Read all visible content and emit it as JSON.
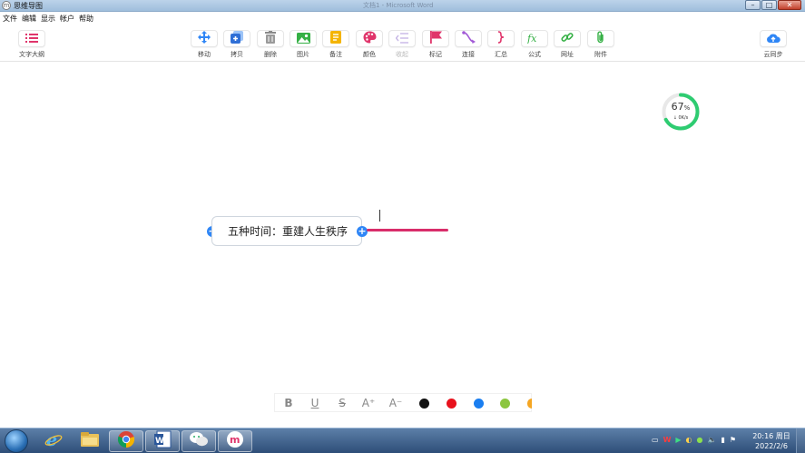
{
  "window": {
    "title": "思维导图",
    "ghost_title": "文档1 - Microsoft Word",
    "minimize": "–",
    "maximize": "□",
    "close": "✕"
  },
  "menu": [
    "文件",
    "编辑",
    "显示",
    "帐户",
    "帮助"
  ],
  "toolbar": {
    "outline": {
      "label": "文字大纲",
      "icon": "list-icon"
    },
    "items": [
      {
        "label": "移动",
        "icon": "move-icon"
      },
      {
        "label": "拷贝",
        "icon": "copy-icon"
      },
      {
        "label": "删除",
        "icon": "trash-icon"
      },
      {
        "label": "图片",
        "icon": "image-icon"
      },
      {
        "label": "备注",
        "icon": "note-icon"
      },
      {
        "label": "颜色",
        "icon": "palette-icon"
      },
      {
        "label": "收起",
        "icon": "collapse-icon",
        "disabled": true
      },
      {
        "label": "标记",
        "icon": "flag-icon"
      },
      {
        "label": "连接",
        "icon": "connect-icon"
      },
      {
        "label": "汇总",
        "icon": "brace-icon"
      },
      {
        "label": "公式",
        "icon": "formula-icon"
      },
      {
        "label": "网址",
        "icon": "link-icon"
      },
      {
        "label": "附件",
        "icon": "paperclip-icon"
      }
    ],
    "sync": {
      "label": "云同步",
      "icon": "cloud-upload-icon"
    }
  },
  "progress": {
    "percent": "67",
    "unit": "%",
    "speed": "0K/s",
    "fraction": 0.67
  },
  "mindmap": {
    "root_text": "五种时间：重建人生秩序",
    "branch_color": "#d92d6a"
  },
  "formatbar": {
    "bold": "B",
    "underline": "U",
    "strike": "S",
    "font_up": "A⁺",
    "font_down": "A⁻",
    "colors": [
      "#111111",
      "#e8121d",
      "#1a7ef0",
      "#8cc63f",
      "#f5a623"
    ]
  },
  "taskbar": {
    "apps": [
      "ie-icon",
      "explorer-icon",
      "chrome-icon",
      "word-icon",
      "wechat-icon",
      "mindmap-app-icon"
    ],
    "time": "20:16 周日",
    "date": "2022/2/6"
  },
  "colors": {
    "accent": "#2f86f6",
    "progress_green": "#2ecc71"
  }
}
